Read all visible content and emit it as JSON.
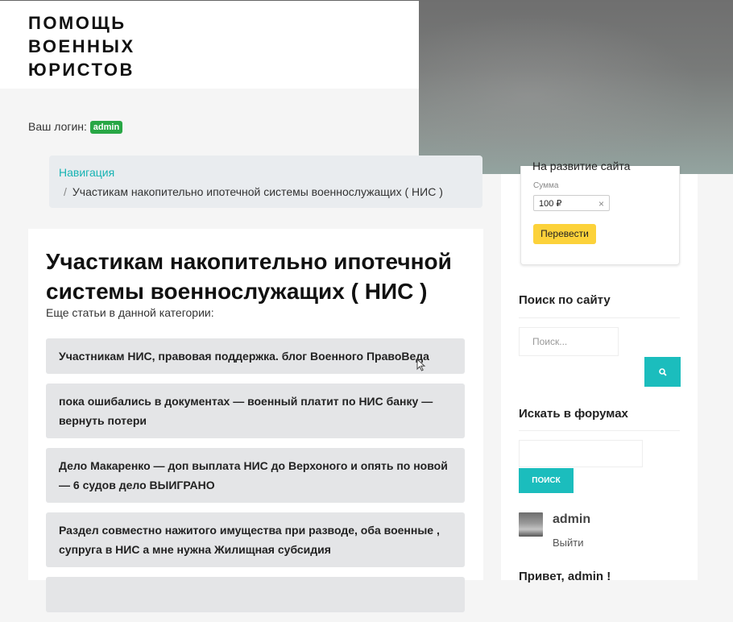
{
  "site": {
    "logo_lines": [
      "ПОМОЩЬ",
      "ВОЕННЫХ",
      "ЮРИСТОВ"
    ]
  },
  "login": {
    "label": "Ваш логин:",
    "user_badge": "admin"
  },
  "breadcrumb": {
    "nav_link": "Навигация",
    "separator": "/",
    "current": "Участикам накопительно ипотечной системы военнослужащих ( НИС )"
  },
  "article": {
    "title": "Участикам накопительно ипотечной системы военнослужащих ( НИС )",
    "subtitle": "Еще статьи в данной категории:",
    "items": [
      "Участникам НИС, правовая поддержка. блог Военного ПравоВеда",
      "пока ошибались в документах — военный платит по НИС банку — вернуть потери",
      "Дело Макаренко — доп выплата НИС до Верхоного и опять по новой — 6 судов дело ВЫИГРАНО",
      "Раздел совместно нажитого имущества при разводе, оба военные , супруга в НИС а мне нужна Жилищная субсидия",
      ""
    ]
  },
  "donate": {
    "title": "На развитие сайта",
    "sum_label": "Сумма",
    "sum_value": "100 ₽",
    "clear_icon": "×",
    "button": "Перевести",
    "button_color": "#fcd23a"
  },
  "search_widget": {
    "title": "Поиск по сайту",
    "placeholder": "Поиск...",
    "icon": "search-icon",
    "accent": "#1bbdbd"
  },
  "forum_widget": {
    "title": "Искать в форумах",
    "button": "ПОИСК"
  },
  "user_widget": {
    "name": "admin",
    "logout": "Выйти"
  },
  "greeting": "Привет, admin !"
}
